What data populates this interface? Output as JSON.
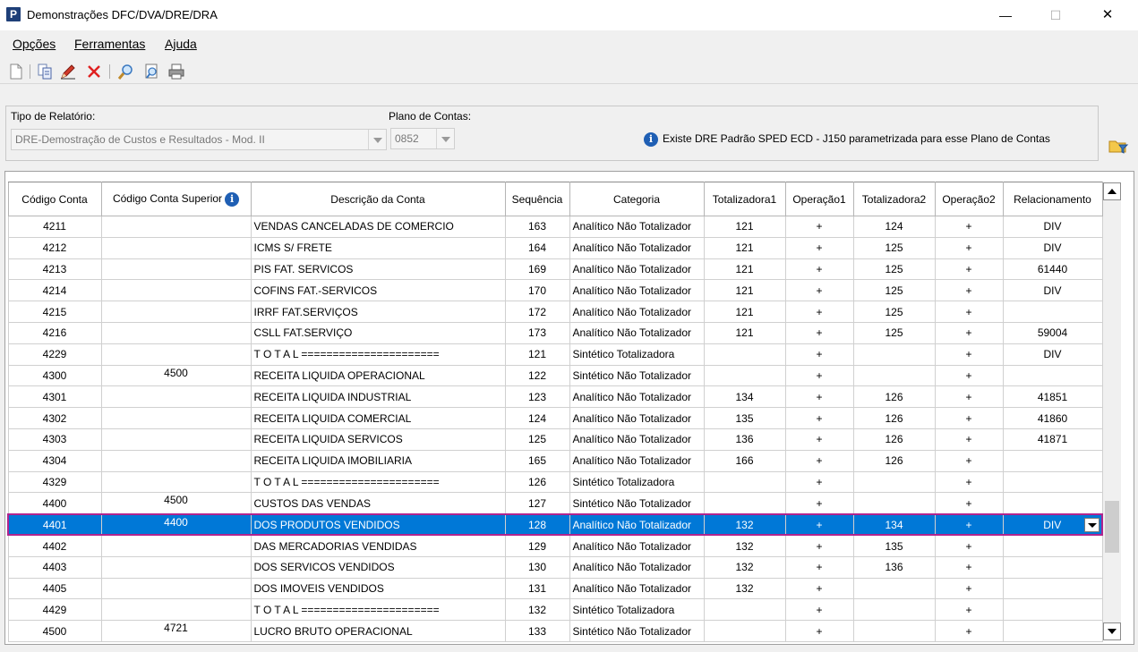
{
  "window": {
    "title": "Demonstrações DFC/DVA/DRE/DRA",
    "app_icon_letter": "P"
  },
  "menu": [
    {
      "label": "Opções"
    },
    {
      "label": "Ferramentas"
    },
    {
      "label": "Ajuda"
    }
  ],
  "toolbar": {
    "icons": [
      "new-document-icon",
      "copy-icon",
      "edit-pencil-icon",
      "delete-x-icon",
      "search-magnifier-icon",
      "preview-icon",
      "print-icon"
    ]
  },
  "filters": {
    "report_type_label": "Tipo de Relatório:",
    "report_type_value": "DRE-Demostração de Custos e Resultados - Mod. II",
    "chart_label": "Plano de Contas:",
    "chart_value": "0852",
    "info_message": "Existe DRE Padrão SPED ECD - J150 parametrizada para esse Plano de Contas"
  },
  "grid": {
    "columns": [
      "Código Conta",
      "Código Conta Superior",
      "Descrição da Conta",
      "Sequência",
      "Categoria",
      "Totalizadora1",
      "Operação1",
      "Totalizadora2",
      "Operação2",
      "Relacionamento"
    ],
    "rows": [
      [
        "4211",
        "",
        "VENDAS CANCELADAS DE COMERCIO",
        "163",
        "Analítico Não Totalizador",
        "121",
        "+",
        "124",
        "+",
        "DIV"
      ],
      [
        "4212",
        "",
        "ICMS S/ FRETE",
        "164",
        "Analítico Não Totalizador",
        "121",
        "+",
        "125",
        "+",
        "DIV"
      ],
      [
        "4213",
        "",
        "PIS FAT. SERVICOS",
        "169",
        "Analítico Não Totalizador",
        "121",
        "+",
        "125",
        "+",
        "61440"
      ],
      [
        "4214",
        "",
        "COFINS FAT.-SERVICOS",
        "170",
        "Analítico Não Totalizador",
        "121",
        "+",
        "125",
        "+",
        "DIV"
      ],
      [
        "4215",
        "",
        "IRRF FAT.SERVIÇOS",
        "172",
        "Analítico Não Totalizador",
        "121",
        "+",
        "125",
        "+",
        ""
      ],
      [
        "4216",
        "",
        "CSLL FAT.SERVIÇO",
        "173",
        "Analítico Não Totalizador",
        "121",
        "+",
        "125",
        "+",
        "59004"
      ],
      [
        "4229",
        "",
        "T O T A L ======================",
        "121",
        "Sintético Totalizadora",
        "",
        "+",
        "",
        "+",
        "DIV"
      ],
      [
        "4300",
        "4500",
        "RECEITA LIQUIDA OPERACIONAL",
        "122",
        "Sintético Não Totalizador",
        "",
        "+",
        "",
        "+",
        ""
      ],
      [
        "4301",
        "",
        "RECEITA LIQUIDA INDUSTRIAL",
        "123",
        "Analítico Não Totalizador",
        "134",
        "+",
        "126",
        "+",
        "41851"
      ],
      [
        "4302",
        "",
        "RECEITA LIQUIDA COMERCIAL",
        "124",
        "Analítico Não Totalizador",
        "135",
        "+",
        "126",
        "+",
        "41860"
      ],
      [
        "4303",
        "",
        "RECEITA LIQUIDA SERVICOS",
        "125",
        "Analítico Não Totalizador",
        "136",
        "+",
        "126",
        "+",
        "41871"
      ],
      [
        "4304",
        "",
        "RECEITA LIQUIDA IMOBILIARIA",
        "165",
        "Analítico Não Totalizador",
        "166",
        "+",
        "126",
        "+",
        ""
      ],
      [
        "4329",
        "",
        "T O T A L ======================",
        "126",
        "Sintético Totalizadora",
        "",
        "+",
        "",
        "+",
        ""
      ],
      [
        "4400",
        "4500",
        "CUSTOS DAS VENDAS",
        "127",
        "Sintético Não Totalizador",
        "",
        "+",
        "",
        "+",
        ""
      ],
      [
        "4401",
        "4400",
        "DOS PRODUTOS VENDIDOS",
        "128",
        "Analítico Não Totalizador",
        "132",
        "+",
        "134",
        "+",
        "DIV"
      ],
      [
        "4402",
        "",
        "DAS MERCADORIAS VENDIDAS",
        "129",
        "Analítico Não Totalizador",
        "132",
        "+",
        "135",
        "+",
        ""
      ],
      [
        "4403",
        "",
        "DOS SERVICOS VENDIDOS",
        "130",
        "Analítico Não Totalizador",
        "132",
        "+",
        "136",
        "+",
        ""
      ],
      [
        "4405",
        "",
        "DOS IMOVEIS VENDIDOS",
        "131",
        "Analítico Não Totalizador",
        "132",
        "+",
        "",
        "+",
        ""
      ],
      [
        "4429",
        "",
        "T O T A L ======================",
        "132",
        "Sintético Totalizadora",
        "",
        "+",
        "",
        "+",
        ""
      ],
      [
        "4500",
        "4721",
        "LUCRO BRUTO OPERACIONAL",
        "133",
        "Sintético Não Totalizador",
        "",
        "+",
        "",
        "+",
        ""
      ]
    ],
    "selected_row_index": 14
  },
  "colors": {
    "selection": "#0078d7",
    "selection_border": "#b0248e"
  }
}
